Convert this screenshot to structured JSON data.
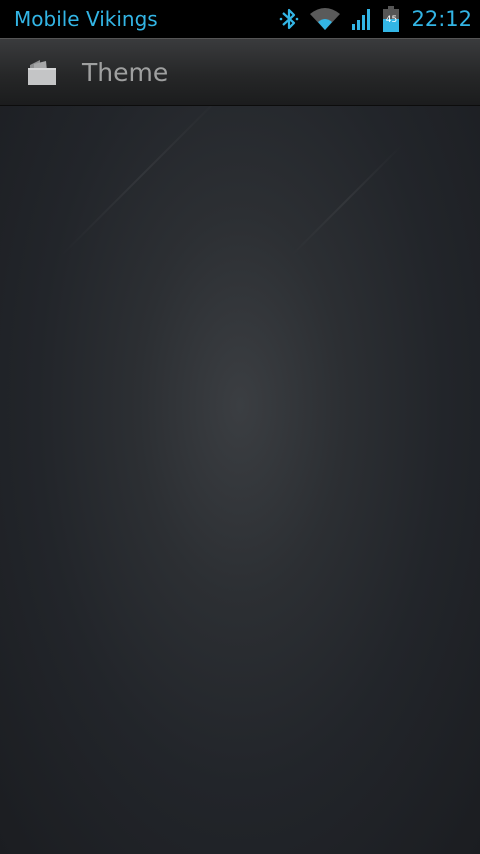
{
  "status_bar": {
    "carrier": "Mobile Vikings",
    "icons": [
      "bluetooth-icon",
      "wifi-icon",
      "signal-icon",
      "battery-icon"
    ],
    "battery_level": "45",
    "time": "22:12",
    "accent_color": "#33b5e5"
  },
  "action_bar": {
    "app_icon": "theme-icon",
    "title": "Theme"
  },
  "colors": {
    "background": "#22252a",
    "title_text": "#9fa0a0"
  }
}
